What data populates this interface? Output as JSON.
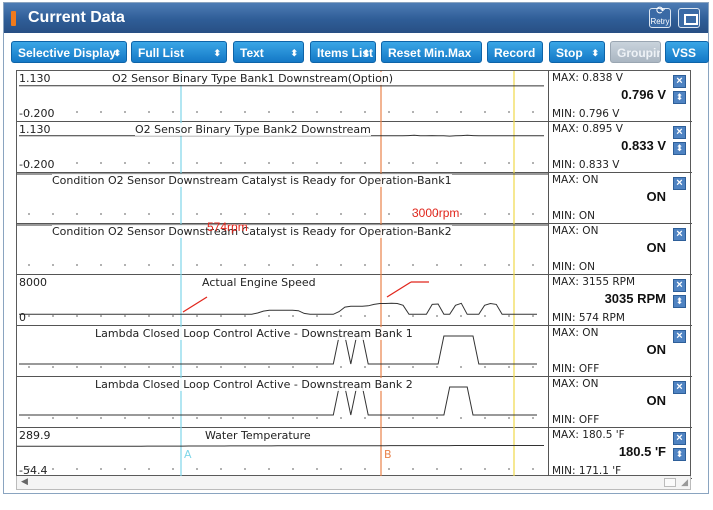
{
  "window": {
    "title": "Current Data",
    "retry_label": "Retry"
  },
  "toolbar": {
    "buttons": [
      {
        "label": "Selective Display",
        "caret": "⬍"
      },
      {
        "label": "Full List",
        "caret": "⬍"
      },
      {
        "label": "Text",
        "caret": "⬍"
      },
      {
        "label": "Items List",
        "caret": "⬍"
      },
      {
        "label": "Reset Min.Max",
        "caret": ""
      },
      {
        "label": "Record",
        "caret": ""
      },
      {
        "label": "Stop",
        "caret": "⬍"
      },
      {
        "label": "Grouping",
        "caret": "",
        "disabled": true
      },
      {
        "label": "VSS",
        "caret": ""
      }
    ]
  },
  "cursors": {
    "a_label": "A",
    "b_label": "B",
    "a_color": "#7fd6e8",
    "b_color": "#e8824a",
    "c_color": "#f0d84a"
  },
  "annotations": {
    "low_rpm": "574rpm",
    "high_rpm": "3000rpm",
    "color": "#e1261c"
  },
  "sensors": [
    {
      "name": "O2 Sensor Binary Type Bank1 Downstream(Option)",
      "y_max": "1.130",
      "y_min": "-0.200",
      "max": "MAX: 0.838 V",
      "current": "0.796 V",
      "min": "MIN: 0.796 V",
      "has_unit_button": true,
      "series": [
        0.81,
        0.81,
        0.81,
        0.81,
        0.81,
        0.81,
        0.81,
        0.81,
        0.81,
        0.81,
        0.81,
        0.81,
        0.81,
        0.81,
        0.81,
        0.81,
        0.81,
        0.81,
        0.81,
        0.81,
        0.81,
        0.81,
        0.81,
        0.81,
        0.81,
        0.81,
        0.81,
        0.81,
        0.81,
        0.81,
        0.81,
        0.81,
        0.81,
        0.81,
        0.81,
        0.81,
        0.81,
        0.81,
        0.81,
        0.81,
        0.81,
        0.8,
        0.8,
        0.8,
        0.8,
        0.8,
        0.8,
        0.8,
        0.8,
        0.8,
        0.8,
        0.8,
        0.8,
        0.8,
        0.8,
        0.8,
        0.8,
        0.8,
        0.8,
        0.8,
        0.8,
        0.8,
        0.8,
        0.8,
        0.8,
        0.8,
        0.8,
        0.8,
        0.8,
        0.8,
        0.8,
        0.8,
        0.8,
        0.8,
        0.8,
        0.8,
        0.8,
        0.8,
        0.8,
        0.8,
        0.8,
        0.8,
        0.8,
        0.8,
        0.8,
        0.8,
        0.8,
        0.8,
        0.8,
        0.8
      ]
    },
    {
      "name": "O2 Sensor Binary Type Bank2 Downstream",
      "y_max": "1.130",
      "y_min": "-0.200",
      "max": "MAX: 0.895 V",
      "current": "0.833 V",
      "min": "MIN: 0.833 V",
      "has_unit_button": true,
      "series": [
        0.84,
        0.84,
        0.84,
        0.84,
        0.84,
        0.84,
        0.84,
        0.84,
        0.84,
        0.84,
        0.84,
        0.84,
        0.84,
        0.84,
        0.84,
        0.84,
        0.84,
        0.84,
        0.84,
        0.84,
        0.84,
        0.84,
        0.84,
        0.84,
        0.84,
        0.84,
        0.84,
        0.84,
        0.84,
        0.84,
        0.84,
        0.84,
        0.84,
        0.84,
        0.84,
        0.84,
        0.84,
        0.84,
        0.84,
        0.84,
        0.84,
        0.84,
        0.84,
        0.84,
        0.84,
        0.84,
        0.84,
        0.84,
        0.84,
        0.84,
        0.84,
        0.84,
        0.84,
        0.84,
        0.84,
        0.84,
        0.84,
        0.84,
        0.84,
        0.84,
        0.84,
        0.84,
        0.84,
        0.84,
        0.84,
        0.84,
        0.85,
        0.86,
        0.84,
        0.84,
        0.85,
        0.84,
        0.84,
        0.83,
        0.84,
        0.85,
        0.86,
        0.85,
        0.84,
        0.84,
        0.84,
        0.84,
        0.84,
        0.84,
        0.84,
        0.84,
        0.84,
        0.84,
        0.84,
        0.84
      ]
    },
    {
      "name": "Condition O2 Sensor Downstream Catalyst is Ready for Operation-Bank1",
      "y_max": "",
      "y_min": "",
      "max": "MAX: ON",
      "current": "ON",
      "min": "MIN: ON",
      "has_unit_button": false,
      "series": []
    },
    {
      "name": "Condition O2 Sensor Downstream Catalyst is Ready for Operation-Bank2",
      "y_max": "",
      "y_min": "",
      "max": "MAX: ON",
      "current": "ON",
      "min": "MIN: ON",
      "has_unit_button": false,
      "series": []
    },
    {
      "name": "Actual Engine Speed",
      "y_max": "8000",
      "y_min": "0",
      "max": "MAX:  3155 RPM",
      "current": "3035 RPM",
      "min": "MIN:   574 RPM",
      "has_unit_button": true,
      "series": [
        600,
        600,
        600,
        600,
        600,
        600,
        600,
        600,
        600,
        600,
        600,
        600,
        600,
        600,
        600,
        600,
        600,
        600,
        600,
        600,
        600,
        600,
        600,
        600,
        600,
        600,
        600,
        600,
        600,
        600,
        600,
        600,
        600,
        600,
        600,
        600,
        600,
        600,
        600,
        600,
        620,
        900,
        1300,
        1500,
        1500,
        1500,
        1500,
        1500,
        1400,
        800,
        600,
        600,
        600,
        600,
        600,
        1200,
        2200,
        2400,
        2400,
        2400,
        2500,
        2800,
        3000,
        3000,
        3050,
        3000,
        2600,
        600,
        600,
        600,
        600,
        2800,
        2900,
        600,
        600,
        2600,
        3050,
        600,
        600,
        600,
        2600,
        3000,
        2800,
        600,
        600,
        600,
        600,
        600,
        600,
        600
      ]
    },
    {
      "name": "Lambda Closed Loop Control Active - Downstream Bank 1",
      "y_max": "",
      "y_min": "",
      "max": "MAX: ON",
      "current": "ON",
      "min": "MIN: OFF",
      "has_unit_button": false,
      "series": [
        0,
        0,
        0,
        0,
        0,
        0,
        0,
        0,
        0,
        0,
        0,
        0,
        0,
        0,
        0,
        0,
        0,
        0,
        0,
        0,
        0,
        0,
        0,
        0,
        0,
        0,
        0,
        0,
        0,
        0,
        0,
        0,
        0,
        0,
        0,
        0,
        0,
        0,
        0,
        0,
        0,
        0,
        0,
        0,
        0,
        0,
        0,
        0,
        0,
        0,
        0,
        0,
        0,
        0,
        0,
        1,
        1,
        0,
        1,
        1,
        0,
        0,
        0,
        0,
        0,
        0,
        0,
        0,
        0,
        0,
        0,
        0,
        0,
        1,
        1,
        1,
        1,
        1,
        1,
        0,
        0,
        0,
        0,
        0,
        0,
        0,
        0,
        0,
        0,
        0
      ]
    },
    {
      "name": "Lambda Closed Loop Control Active - Downstream Bank 2",
      "y_max": "",
      "y_min": "",
      "max": "MAX: ON",
      "current": "ON",
      "min": "MIN: OFF",
      "has_unit_button": false,
      "series": [
        0,
        0,
        0,
        0,
        0,
        0,
        0,
        0,
        0,
        0,
        0,
        0,
        0,
        0,
        0,
        0,
        0,
        0,
        0,
        0,
        0,
        0,
        0,
        0,
        0,
        0,
        0,
        0,
        0,
        0,
        0,
        0,
        0,
        0,
        0,
        0,
        0,
        0,
        0,
        0,
        0,
        0,
        0,
        0,
        0,
        0,
        0,
        0,
        0,
        0,
        0,
        0,
        0,
        0,
        0,
        1,
        1,
        0,
        1,
        1,
        0,
        0,
        0,
        0,
        0,
        0,
        0,
        0,
        0,
        0,
        0,
        0,
        0,
        0,
        1,
        1,
        1,
        1,
        0,
        0,
        0,
        0,
        0,
        0,
        0,
        0,
        0,
        0,
        0,
        0
      ]
    },
    {
      "name": "Water Temperature",
      "y_max": "289.9",
      "y_min": "-54.4",
      "max": "MAX: 180.5 'F",
      "current": "180.5 'F",
      "min": "MIN: 171.1 'F",
      "has_unit_button": true,
      "series": [
        172,
        172,
        172,
        172,
        172,
        172,
        172,
        172,
        172,
        172,
        172,
        172,
        172,
        172,
        172,
        173,
        173,
        173,
        173,
        173,
        173,
        173,
        174,
        174,
        174,
        174,
        174,
        174,
        174,
        175,
        175,
        175,
        175,
        175,
        175,
        175,
        176,
        176,
        176,
        176,
        176,
        176,
        176,
        176,
        177,
        177,
        177,
        177,
        177,
        177,
        177,
        177,
        177,
        178,
        178,
        178,
        178,
        178,
        178,
        178,
        178,
        178,
        178,
        179,
        179,
        179,
        179,
        179,
        179,
        179,
        179,
        179,
        179,
        179,
        180,
        180,
        180,
        180,
        180,
        180,
        180,
        180,
        180,
        180,
        180,
        180,
        180,
        180,
        180,
        180
      ]
    }
  ]
}
